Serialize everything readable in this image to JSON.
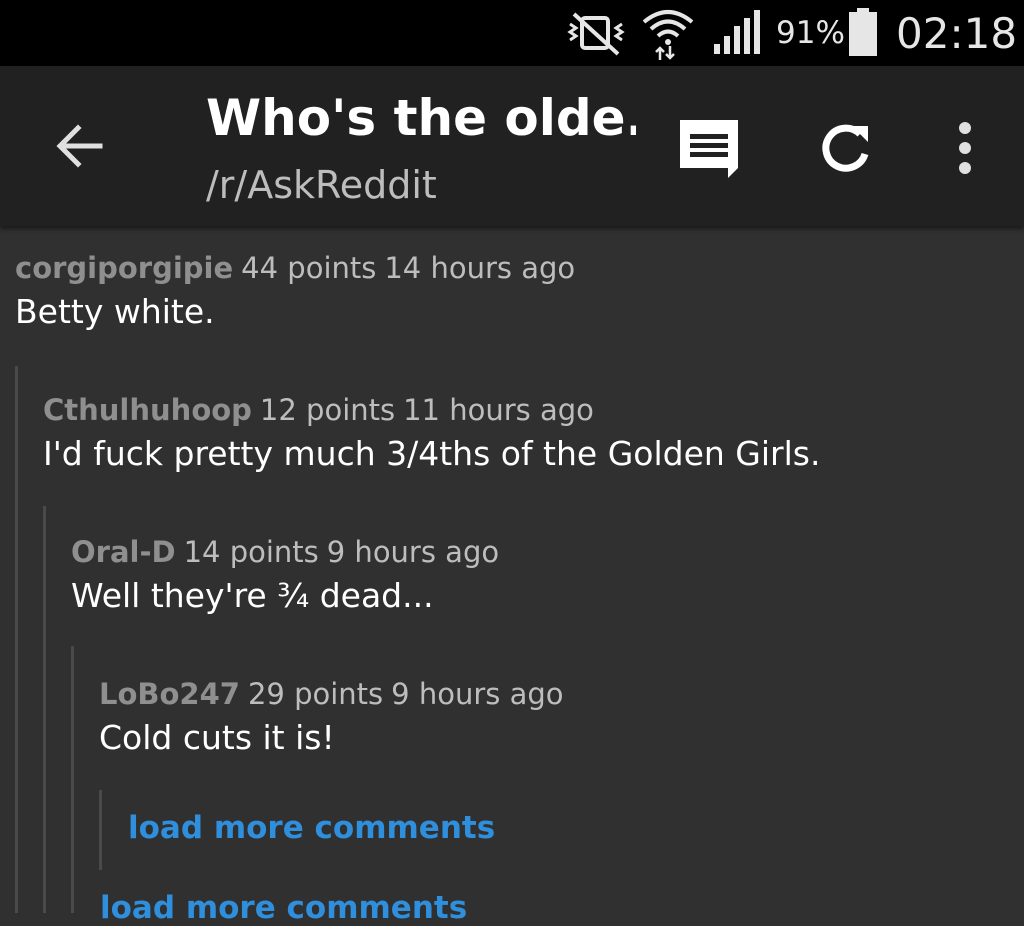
{
  "status_bar": {
    "battery": "91%",
    "time": "02:18",
    "icons": [
      "mute-vibrate-icon",
      "wifi-icon",
      "signal-icon",
      "battery-icon"
    ]
  },
  "app_bar": {
    "title": "Who's the olde...",
    "subtitle": "/r/AskReddit",
    "icons": [
      "back-arrow-icon",
      "comment-icon",
      "refresh-icon",
      "more-vert-icon"
    ],
    "background": "#212121"
  },
  "comments": [
    {
      "author": "corgiporgipie",
      "points": "44 points",
      "time": "14 hours ago",
      "body": "Betty white."
    },
    {
      "author": "Cthulhuhoop",
      "points": "12 points",
      "time": "11 hours ago",
      "body": "I'd fuck pretty much 3/4ths of the Golden Girls."
    },
    {
      "author": "Oral-D",
      "points": "14 points",
      "time": "9 hours ago",
      "body": "Well they're ¾ dead..."
    },
    {
      "author": "LoBo247",
      "points": "29 points",
      "time": "9 hours ago",
      "body": "Cold cuts it is!"
    }
  ],
  "load_more": [
    "load more comments",
    "load more comments"
  ],
  "colors": {
    "background": "#303030",
    "link": "#2f8fdc",
    "author": "#8f8f8f",
    "meta": "#bdbdbd"
  }
}
